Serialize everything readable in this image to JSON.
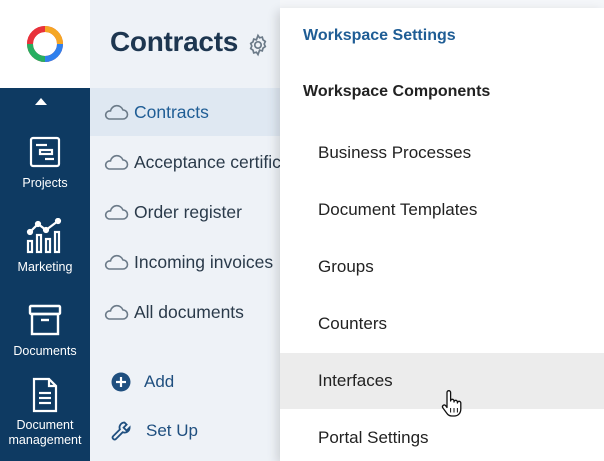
{
  "colors": {
    "rail": "#0e3a62",
    "panel": "#eef2f7",
    "accent": "#1f5d95",
    "hover": "#ececec"
  },
  "rail": {
    "logo_icon": "app-logo-icon",
    "scroll_up_icon": "caret-up-icon",
    "items": [
      {
        "label": "Projects",
        "icon": "projects-icon"
      },
      {
        "label": "Marketing",
        "icon": "marketing-chart-icon"
      },
      {
        "label": "Documents",
        "icon": "archive-box-icon"
      },
      {
        "label": "Document management",
        "icon": "document-icon"
      }
    ]
  },
  "workspace": {
    "title": "Contracts",
    "settings_icon": "gear-icon",
    "items": [
      {
        "label": "Contracts",
        "icon": "cloud-icon",
        "active": true
      },
      {
        "label": "Acceptance certificates",
        "icon": "cloud-icon"
      },
      {
        "label": "Order register",
        "icon": "cloud-icon"
      },
      {
        "label": "Incoming invoices",
        "icon": "cloud-icon"
      },
      {
        "label": "All documents",
        "icon": "cloud-icon"
      }
    ],
    "actions": {
      "add": "Add",
      "setup": "Set Up"
    }
  },
  "menu": {
    "header": "Workspace Settings",
    "section": "Workspace Components",
    "items": [
      "Business Processes",
      "Document Templates",
      "Groups",
      "Counters",
      "Interfaces",
      "Portal Settings"
    ],
    "hovered_item": "Interfaces"
  }
}
